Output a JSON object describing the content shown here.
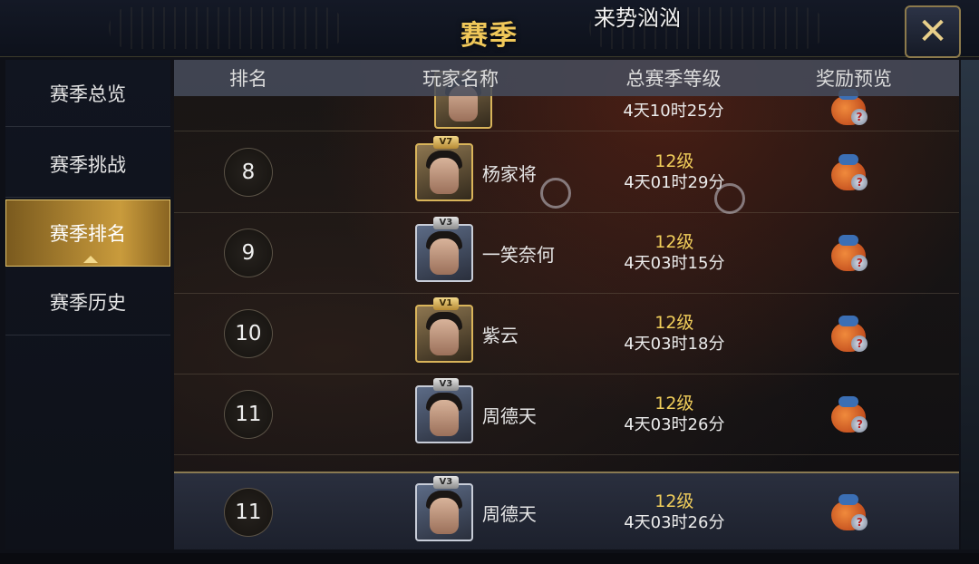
{
  "header": {
    "title": "赛季",
    "broadcast": "来势汹汹",
    "close_glyph": "✕"
  },
  "sidebar": {
    "items": [
      {
        "label": "赛季总览",
        "active": false
      },
      {
        "label": "赛季挑战",
        "active": false
      },
      {
        "label": "赛季排名",
        "active": true
      },
      {
        "label": "赛季历史",
        "active": false
      }
    ]
  },
  "table": {
    "headers": {
      "rank": "排名",
      "name": "玩家名称",
      "level": "总赛季等级",
      "reward": "奖励预览"
    },
    "partial_row": {
      "time": "4天10时25分"
    },
    "rows": [
      {
        "rank": "8",
        "vip": "V7",
        "vip_tier": "gold",
        "name": "杨家将",
        "level": "12级",
        "time": "4天01时29分"
      },
      {
        "rank": "9",
        "vip": "V3",
        "vip_tier": "silver",
        "name": "一笑奈何",
        "level": "12级",
        "time": "4天03时15分"
      },
      {
        "rank": "10",
        "vip": "V1",
        "vip_tier": "gold",
        "name": "紫云",
        "level": "12级",
        "time": "4天03时18分"
      },
      {
        "rank": "11",
        "vip": "V3",
        "vip_tier": "silver",
        "name": "周德天",
        "level": "12级",
        "time": "4天03时26分"
      }
    ],
    "my_row": {
      "rank": "11",
      "vip": "V3",
      "name": "周德天",
      "level": "12级",
      "time": "4天03时26分"
    }
  },
  "colors": {
    "title": "#f0c85a",
    "level": "#f2cf5b",
    "active_tab": "#c99b3c"
  },
  "icons": [
    "close-icon",
    "reward-bag-icon",
    "avatar-icon"
  ]
}
